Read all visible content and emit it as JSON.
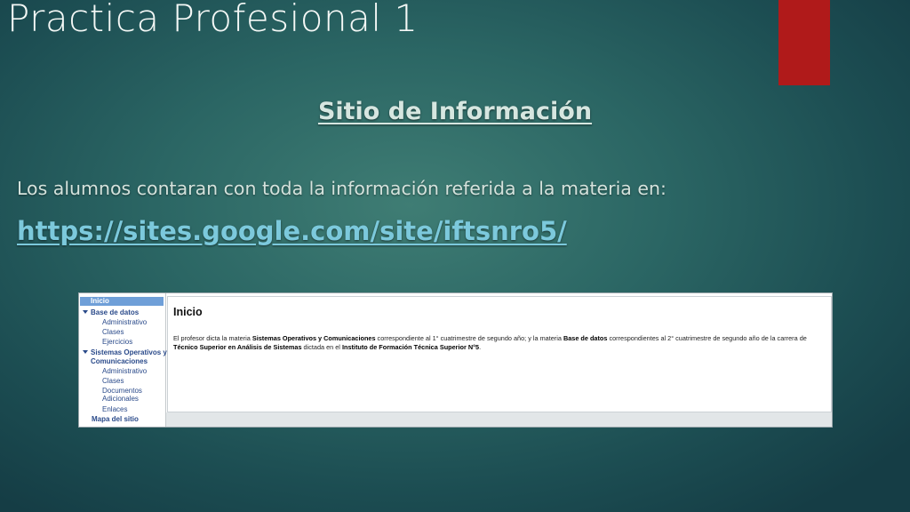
{
  "slide": {
    "title": "Practica Profesional 1",
    "subtitle": "Sitio de Información",
    "description": "Los alumnos contaran con toda la información referida a la materia en:",
    "link": "https://sites.google.com/site/iftsnro5/"
  },
  "colors": {
    "accent_red": "#b01a1a",
    "link": "#7cc9dc",
    "background": "#2b6664"
  },
  "site": {
    "sidebar": {
      "selected": "Inicio",
      "base_datos": "Base de datos",
      "bd_admin": "Administrativo",
      "bd_clases": "Clases",
      "bd_ejercicios": "Ejercicios",
      "so_line1": "Sistemas Operativos y",
      "so_line2": "Comunicaciones",
      "so_admin": "Administrativo",
      "so_clases": "Clases",
      "so_docs1": "Documentos",
      "so_docs2": "Adicionales",
      "so_enlaces": "Enlaces",
      "mapa": "Mapa del sitio"
    },
    "page": {
      "heading": "Inicio",
      "t1": "El profesor dicta la materia ",
      "b1": "Sistemas Operativos y Comunicaciones",
      "t2": " correspondiente al 1° cuatrimestre de segundo año; y la materia ",
      "b2": "Base de datos",
      "t3": " correspondientes al 2° cuatrimestre de segundo año de la carrera de ",
      "b3": "Técnico Superior en Análisis de Sistemas",
      "t4": " dictada en el ",
      "b4": "Instituto de Formación Técnica Superior N°5",
      "t5": "."
    }
  }
}
